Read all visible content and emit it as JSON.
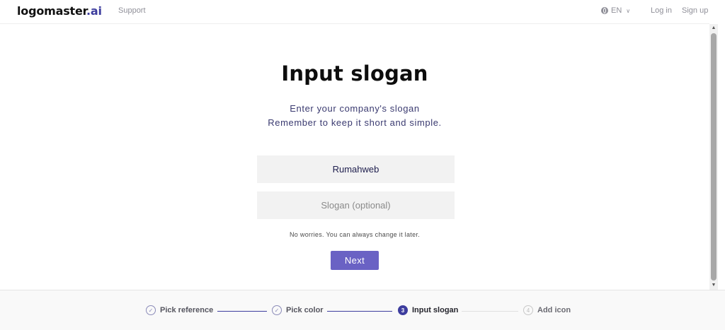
{
  "header": {
    "logo_main": "logomaster",
    "logo_suffix": ".ai",
    "support_label": "Support",
    "language": "EN",
    "login_label": "Log in",
    "signup_label": "Sign up"
  },
  "main": {
    "title": "Input slogan",
    "subtitle_line1": "Enter your company's slogan",
    "subtitle_line2": "Remember to keep it short and simple.",
    "company_name_value": "Rumahweb",
    "slogan_placeholder": "Slogan (optional)",
    "note": "No worries. You can always change it later.",
    "next_label": "Next"
  },
  "steps": [
    {
      "label": "Pick reference",
      "state": "done",
      "marker": "check"
    },
    {
      "label": "Pick color",
      "state": "done",
      "marker": "check"
    },
    {
      "label": "Input slogan",
      "state": "active",
      "marker": "3"
    },
    {
      "label": "Add icon",
      "state": "pending",
      "marker": "4"
    }
  ],
  "colors": {
    "accent": "#3d3d9e",
    "button": "#6a62c4",
    "field_bg": "#f2f2f2"
  }
}
